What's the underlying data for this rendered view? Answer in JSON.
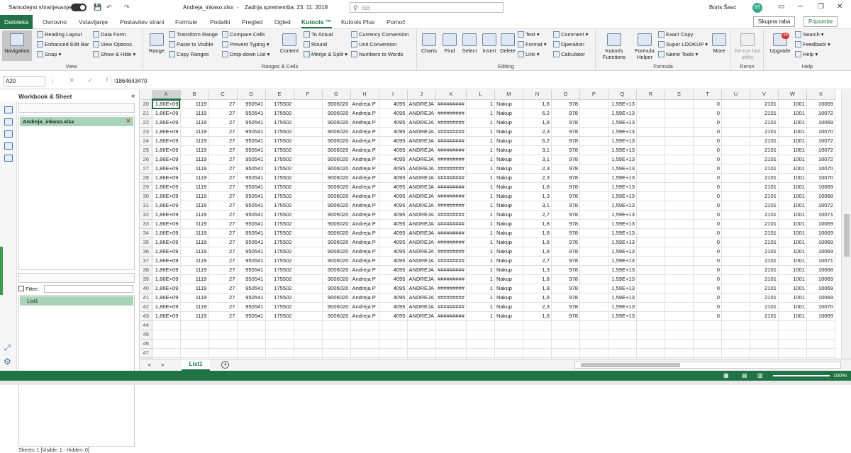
{
  "titlebar": {
    "autosave": "Samodejno shranjevanje",
    "filename": "Andreja_inkaso.xlsx",
    "separator": "-",
    "modified": "Zadnja sprememba: 23. 11. 2018",
    "search": "Išči",
    "user": "Boris Šavc",
    "initials": "BŠ",
    "undo": "↶",
    "redo": "↷",
    "save": "💾"
  },
  "tabs": [
    "Datoteka",
    "Osnovno",
    "Vstavljanje",
    "Postavitev strani",
    "Formule",
    "Podatki",
    "Pregled",
    "Ogled",
    "Kutools ™",
    "Kutools Plus",
    "Pomoč"
  ],
  "share": {
    "group": "Skupna raba",
    "comments": "Pripombe"
  },
  "ribbon": {
    "view": {
      "label": "View",
      "navigation": "Navigation",
      "reading": "Reading Layout",
      "edit_bar": "Enhanced Edit Bar",
      "snap": "Snap",
      "data_form": "Data Form",
      "view_options": "View Options",
      "show_hide": "Show & Hide"
    },
    "ranges": {
      "label": "Ranges & Cells",
      "range": "Range",
      "transform": "Transform Range",
      "paste_visible": "Paste to Visible",
      "copy_ranges": "Copy Ranges",
      "compare": "Compare Cells",
      "prevent": "Prevent Typing",
      "dropdown": "Drop-down List",
      "content": "Content",
      "to_actual": "To Actual",
      "round": "Round",
      "merge": "Merge & Split",
      "currency": "Currency Conversion",
      "unit": "Unit Conversion",
      "numbers": "Numbers to Words"
    },
    "editing": {
      "label": "Editing",
      "charts": "Charts",
      "find": "Find",
      "select": "Select",
      "insert": "Insert",
      "delete": "Delete",
      "text": "Text",
      "format": "Format",
      "link": "Link",
      "comment": "Comment",
      "operation": "Operation",
      "calculator": "Calculator"
    },
    "formula": {
      "label": "Formula",
      "functions": "Kutools Functions",
      "helper": "Formula Helper",
      "exact": "Exact Copy",
      "super": "Super LOOKUP",
      "name_tools": "Name Tools",
      "more": "More"
    },
    "rerun": {
      "label": "Rerun",
      "rerun": "Re-run last utility"
    },
    "help": {
      "label": "Help",
      "upgrade": "Upgrade",
      "search": "Search",
      "feedback": "Feedback",
      "help": "Help",
      "badge": "24"
    }
  },
  "formula_bar": {
    "name_box": "A20",
    "value": "1864643470",
    "fx": "fx"
  },
  "pane": {
    "title": "Workbook & Sheet",
    "collapse": "«",
    "workbook": "Andreja_inkaso.xlsx",
    "filter_label": "Filter:",
    "sheet": "List1",
    "status": "Sheets: 1  [Visible: 1 - Hidden: 0]"
  },
  "columns": [
    "A",
    "B",
    "C",
    "D",
    "E",
    "F",
    "G",
    "H",
    "I",
    "J",
    "K",
    "L",
    "M",
    "N",
    "O",
    "P",
    "Q",
    "R",
    "S",
    "T",
    "U",
    "V",
    "W",
    "X"
  ],
  "rows_data": [
    {
      "r": "20",
      "n": "1,8",
      "x": "10069"
    },
    {
      "r": "21",
      "n": "6,2",
      "x": "10072"
    },
    {
      "r": "22",
      "n": "1,8",
      "x": "10069"
    },
    {
      "r": "23",
      "n": "2,3",
      "x": "10070"
    },
    {
      "r": "24",
      "n": "6,2",
      "x": "10072"
    },
    {
      "r": "25",
      "n": "3,1",
      "x": "10072"
    },
    {
      "r": "26",
      "n": "3,1",
      "x": "10072"
    },
    {
      "r": "27",
      "n": "2,3",
      "x": "10070"
    },
    {
      "r": "28",
      "n": "2,3",
      "x": "10070"
    },
    {
      "r": "29",
      "n": "1,8",
      "x": "10069"
    },
    {
      "r": "30",
      "n": "1,3",
      "x": "10068"
    },
    {
      "r": "31",
      "n": "3,1",
      "x": "10072"
    },
    {
      "r": "32",
      "n": "2,7",
      "x": "10071"
    },
    {
      "r": "33",
      "n": "1,8",
      "x": "10069"
    },
    {
      "r": "34",
      "n": "1,8",
      "x": "10069"
    },
    {
      "r": "35",
      "n": "1,8",
      "x": "10069"
    },
    {
      "r": "36",
      "n": "1,8",
      "x": "10069"
    },
    {
      "r": "37",
      "n": "2,7",
      "x": "10071"
    },
    {
      "r": "38",
      "n": "1,3",
      "x": "10068"
    },
    {
      "r": "39",
      "n": "1,8",
      "x": "10069"
    },
    {
      "r": "40",
      "n": "1,8",
      "x": "10069"
    },
    {
      "r": "41",
      "n": "1,8",
      "x": "10069"
    },
    {
      "r": "42",
      "n": "2,3",
      "x": "10070"
    },
    {
      "r": "43",
      "n": "1,8",
      "x": "10069"
    }
  ],
  "constant_cells": {
    "A": "1,86E+09",
    "B": "1119",
    "C": "27",
    "D": "950541",
    "E": "175502",
    "G": "9006020",
    "H": "Andreja P",
    "I": "4095",
    "J": "ANDREJA",
    "K": "#########",
    "L": "1",
    "M": "Nakup",
    "O": "978",
    "Q": "1,59E+13",
    "T": "0",
    "V": "2101",
    "W": "1001"
  },
  "empty_rows": [
    "44",
    "45",
    "46",
    "47",
    "48"
  ],
  "sheet_tab": "List1",
  "add_sheet": "+",
  "status": {
    "zoom": "100%"
  },
  "colors": {
    "accent": "#217346"
  }
}
